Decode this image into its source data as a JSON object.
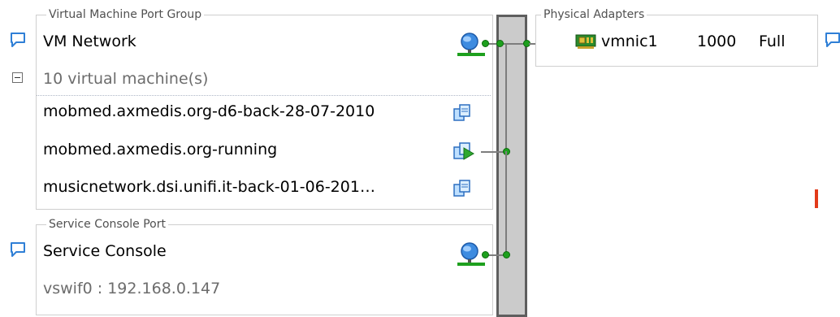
{
  "vm_port_group": {
    "legend": "Virtual Machine Port Group",
    "name": "VM Network",
    "vm_count_label": "10 virtual machine(s)",
    "vms": [
      {
        "name": "mobmed.axmedis.org-d6-back-28-07-2010",
        "state_icon": "vm-icon"
      },
      {
        "name": "mobmed.axmedis.org-running",
        "state_icon": "vm-running-icon"
      },
      {
        "name": "musicnetwork.dsi.unifi.it-back-01-06-201…",
        "state_icon": "vm-icon"
      }
    ]
  },
  "service_console": {
    "legend": "Service Console Port",
    "name": "Service Console",
    "address": "vswif0 : 192.168.0.147"
  },
  "physical_adapters": {
    "legend": "Physical Adapters",
    "adapter": {
      "name": "vmnic1",
      "speed": "1000",
      "duplex": "Full"
    }
  },
  "colors": {
    "node_green": "#1ea01e",
    "switch_gray": "#cbcbcb",
    "bubble_blue": "#2f7fd6",
    "alert_red": "#e23a1a"
  }
}
